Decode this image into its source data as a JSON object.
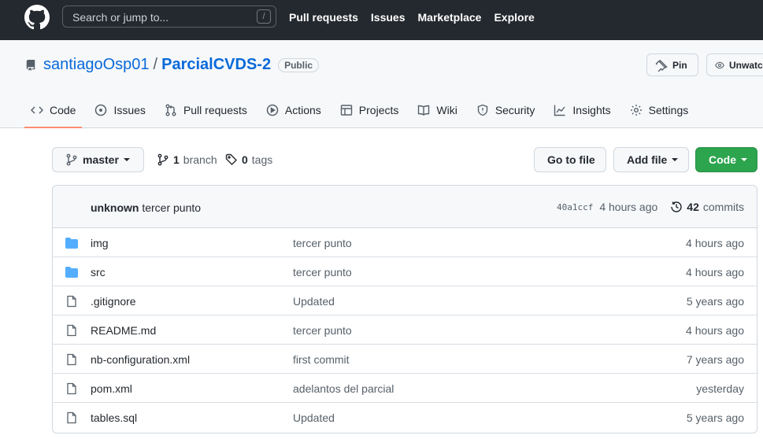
{
  "header": {
    "search_placeholder": "Search or jump to...",
    "search_key": "/",
    "nav": [
      "Pull requests",
      "Issues",
      "Marketplace",
      "Explore"
    ]
  },
  "repo": {
    "owner": "santiagoOsp01",
    "separator": "/",
    "name": "ParcialCVDS-2",
    "visibility": "Public",
    "pin_label": "Pin",
    "watch_label": "Unwatch"
  },
  "tabs": [
    {
      "label": "Code",
      "icon": "code-icon"
    },
    {
      "label": "Issues",
      "icon": "issue-icon"
    },
    {
      "label": "Pull requests",
      "icon": "pull-request-icon"
    },
    {
      "label": "Actions",
      "icon": "play-icon"
    },
    {
      "label": "Projects",
      "icon": "table-icon"
    },
    {
      "label": "Wiki",
      "icon": "book-icon"
    },
    {
      "label": "Security",
      "icon": "shield-icon"
    },
    {
      "label": "Insights",
      "icon": "graph-icon"
    },
    {
      "label": "Settings",
      "icon": "gear-icon"
    }
  ],
  "toolbar": {
    "branch": "master",
    "branch_count": "1",
    "branch_label": "branch",
    "tag_count": "0",
    "tag_label": "tags",
    "goto_label": "Go to file",
    "addfile_label": "Add file",
    "code_label": "Code"
  },
  "commit": {
    "author": "unknown",
    "message": "tercer punto",
    "sha": "40a1ccf",
    "age": "4 hours ago",
    "count": "42",
    "count_label": "commits"
  },
  "files": [
    {
      "type": "folder",
      "name": "img",
      "message": "tercer punto",
      "age": "4 hours ago"
    },
    {
      "type": "folder",
      "name": "src",
      "message": "tercer punto",
      "age": "4 hours ago"
    },
    {
      "type": "file",
      "name": ".gitignore",
      "message": "Updated",
      "age": "5 years ago"
    },
    {
      "type": "file",
      "name": "README.md",
      "message": "tercer punto",
      "age": "4 hours ago"
    },
    {
      "type": "file",
      "name": "nb-configuration.xml",
      "message": "first commit",
      "age": "7 years ago"
    },
    {
      "type": "file",
      "name": "pom.xml",
      "message": "adelantos del parcial",
      "age": "yesterday"
    },
    {
      "type": "file",
      "name": "tables.sql",
      "message": "Updated",
      "age": "5 years ago"
    }
  ],
  "colors": {
    "header_bg": "#24292f",
    "link": "#0969da",
    "primary_button": "#2da44e",
    "active_tab_underline": "#fd8c73",
    "folder_icon": "#54aeff"
  }
}
